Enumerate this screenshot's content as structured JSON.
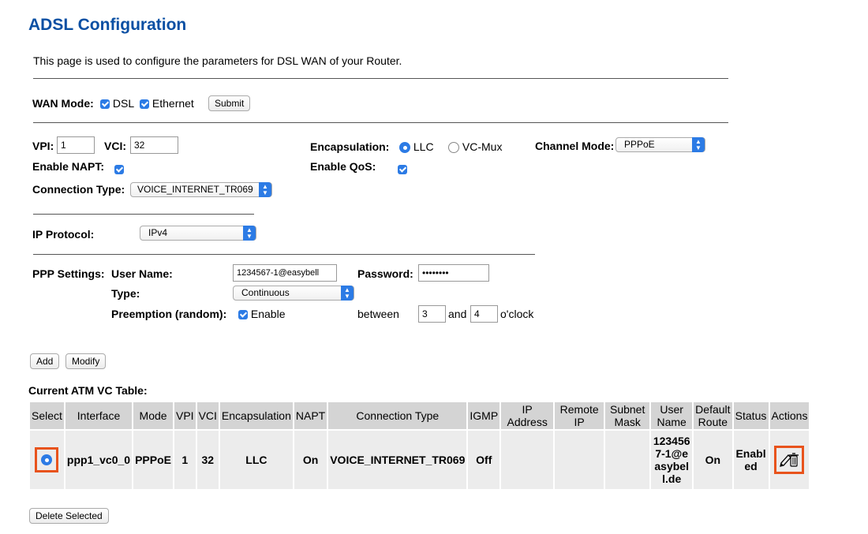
{
  "page": {
    "title": "ADSL Configuration",
    "description": "This page is used to configure the parameters for DSL WAN of your Router."
  },
  "wan_mode": {
    "label": "WAN Mode:",
    "dsl_label": "DSL",
    "ethernet_label": "Ethernet",
    "submit_label": "Submit",
    "dsl_checked": true,
    "ethernet_checked": true
  },
  "vc": {
    "vpi_label": "VPI:",
    "vpi_value": "1",
    "vci_label": "VCI:",
    "vci_value": "32",
    "encapsulation_label": "Encapsulation:",
    "llc_label": "LLC",
    "vcmux_label": "VC-Mux",
    "encapsulation_selected": "LLC",
    "channel_mode_label": "Channel Mode:",
    "channel_mode_value": "PPPoE",
    "napt_label": "Enable NAPT:",
    "napt_checked": true,
    "qos_label": "Enable QoS:",
    "qos_checked": true,
    "connection_type_label": "Connection Type:",
    "connection_type_value": "VOICE_INTERNET_TR069"
  },
  "ip": {
    "protocol_label": "IP Protocol:",
    "protocol_value": "IPv4"
  },
  "ppp": {
    "settings_label": "PPP Settings:",
    "username_label": "User Name:",
    "username_value": "1234567-1@easybell",
    "password_label": "Password:",
    "password_value": "••••••••",
    "type_label": "Type:",
    "type_value": "Continuous",
    "preemption_label": "Preemption (random):",
    "enable_label": "Enable",
    "enable_checked": true,
    "between_label": "between",
    "between_from": "3",
    "and_label": "and",
    "between_to": "4",
    "oclock_label": "o'clock"
  },
  "actions": {
    "add_label": "Add",
    "modify_label": "Modify",
    "delete_selected_label": "Delete Selected"
  },
  "table": {
    "title": "Current ATM VC Table:",
    "headers": [
      "Select",
      "Interface",
      "Mode",
      "VPI",
      "VCI",
      "Encapsulation",
      "NAPT",
      "Connection Type",
      "IGMP",
      "IP Address",
      "Remote IP",
      "Subnet Mask",
      "User Name",
      "Default Route",
      "Status",
      "Actions"
    ],
    "rows": [
      {
        "interface": "ppp1_vc0_0",
        "mode": "PPPoE",
        "vpi": "1",
        "vci": "32",
        "encapsulation": "LLC",
        "napt": "On",
        "connection_type": "VOICE_INTERNET_TR069",
        "igmp": "Off",
        "ip_address": "",
        "remote_ip": "",
        "subnet_mask": "",
        "user_name": "1234567-1@easybell.de",
        "default_route": "On",
        "status": "Enabled",
        "selected": true,
        "action_icons": [
          "pencil-icon",
          "trash-icon"
        ]
      }
    ]
  },
  "colors": {
    "title": "#0a4fa3",
    "accent": "#2c7be5",
    "highlight": "#e8531c"
  }
}
